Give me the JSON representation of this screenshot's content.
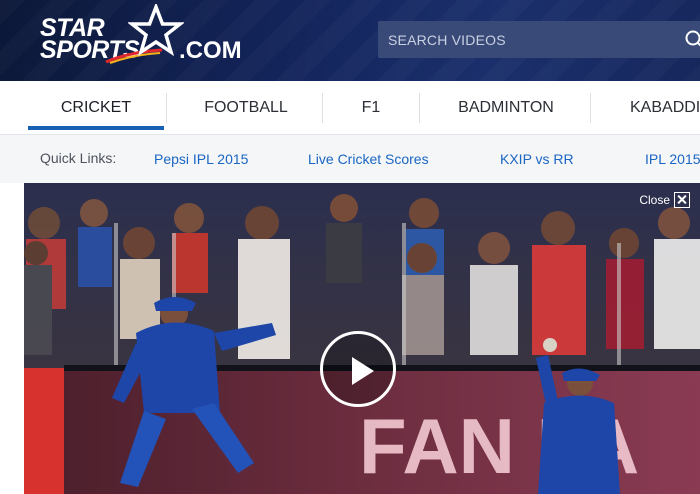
{
  "brand": {
    "line1": "STAR",
    "line2": "SPORTS",
    "suffix": ".COM"
  },
  "search": {
    "placeholder": "SEARCH VIDEOS"
  },
  "nav": {
    "tabs": [
      {
        "label": "CRICKET",
        "active": true
      },
      {
        "label": "FOOTBALL",
        "active": false
      },
      {
        "label": "F1",
        "active": false
      },
      {
        "label": "BADMINTON",
        "active": false
      },
      {
        "label": "KABADDI",
        "active": false
      }
    ]
  },
  "quick_links": {
    "label": "Quick Links:",
    "items": [
      "Pepsi IPL 2015",
      "Live Cricket Scores",
      "KXIP vs RR",
      "IPL 2015"
    ]
  },
  "video": {
    "close_label": "Close",
    "banner_text": "FAN PA"
  },
  "icons": {
    "search": "search-icon",
    "close": "close-icon",
    "play": "play-icon",
    "star": "star-icon"
  },
  "colors": {
    "header_bg": "#13245a",
    "accent": "#1760b4",
    "link": "#1a66c2",
    "jersey": "#1d46a8"
  }
}
